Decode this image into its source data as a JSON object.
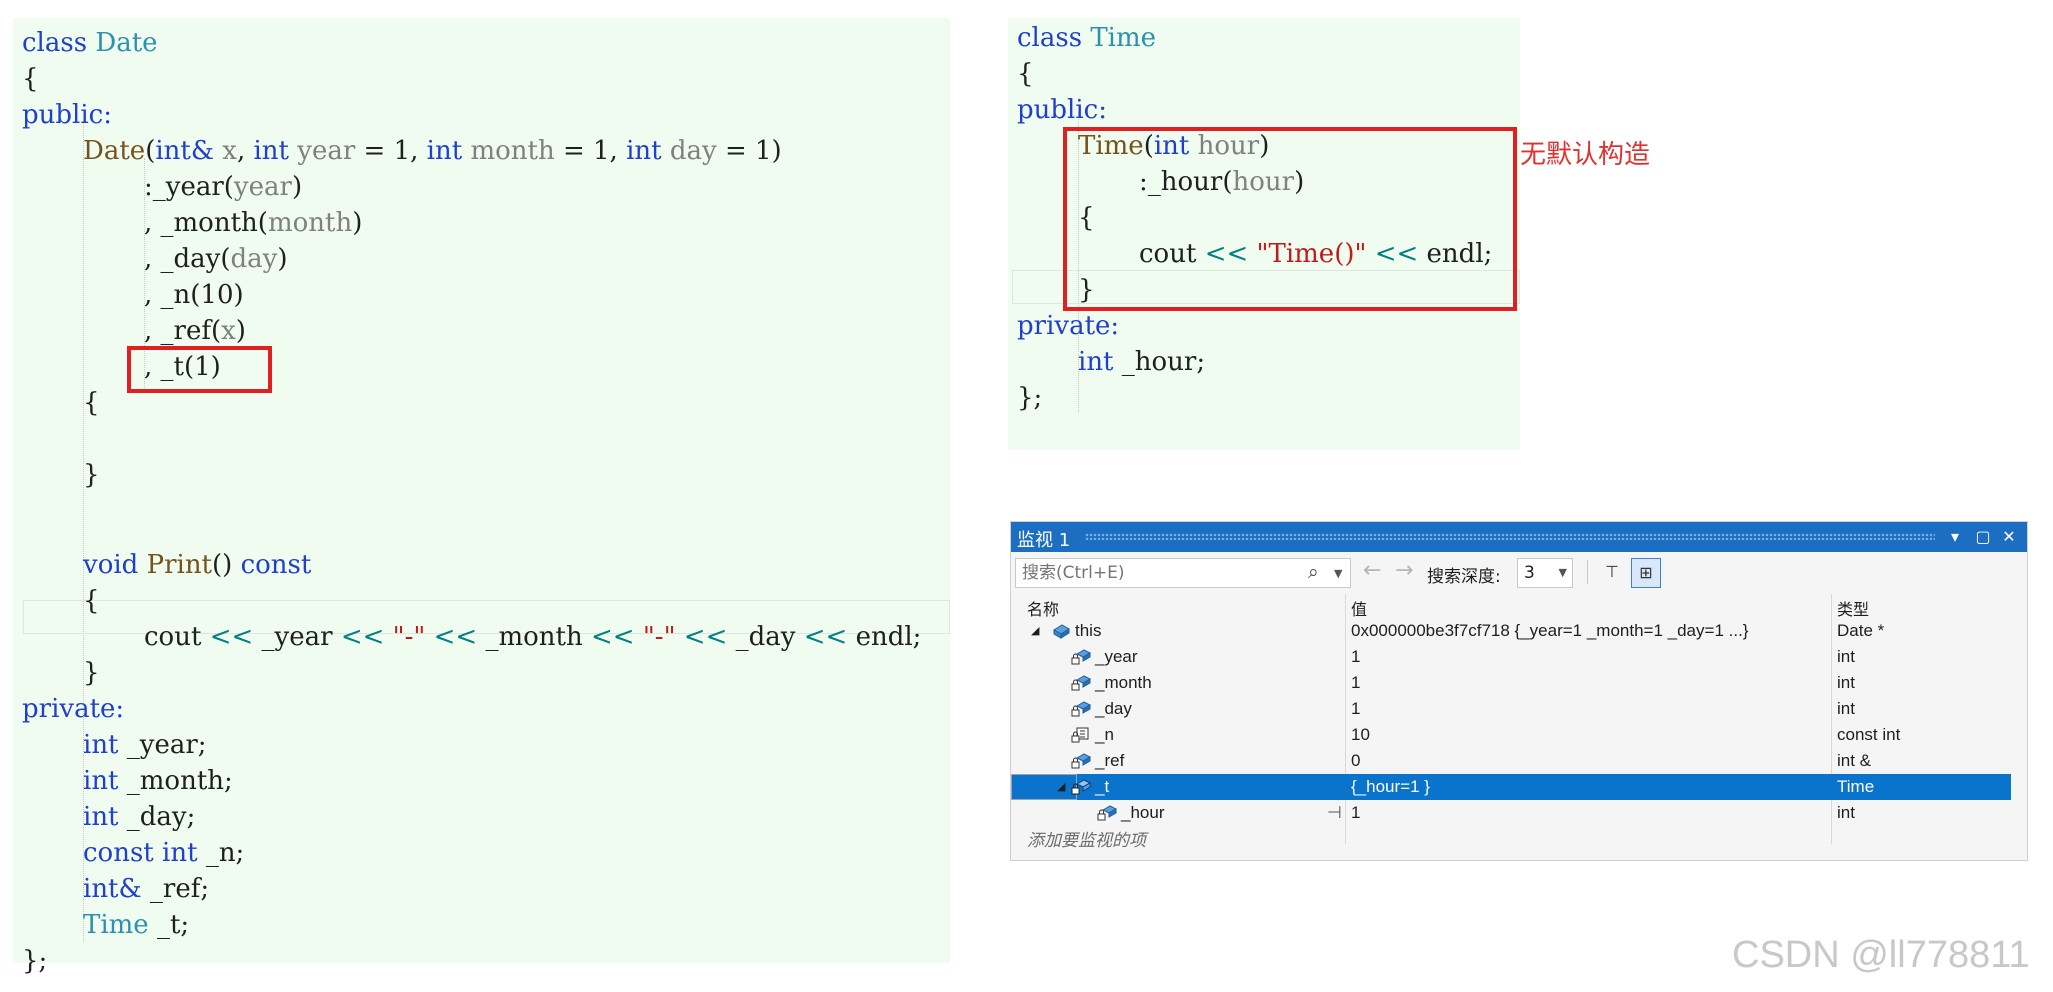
{
  "date_code": {
    "class_kw": "class",
    "class_name": "Date",
    "brace_open": "{",
    "brace_close": "};",
    "public_label": "public:",
    "private_label": "private:",
    "ctor": {
      "name": "Date",
      "p1_type": "int&",
      "p1_name": "x",
      "p2_type": "int",
      "p2_name": "year",
      "p2_def": "= 1,",
      "p3_type": "int",
      "p3_name": "month",
      "p3_def": "= 1,",
      "p4_type": "int",
      "p4_name": "day",
      "p4_def": "= 1)"
    },
    "init_year": ":_year",
    "init_year_arg": "year",
    "init_month": ", _month",
    "init_month_arg": "month",
    "init_day": ", _day",
    "init_day_arg": "day",
    "init_n": ", _n(10)",
    "init_ref": ", _ref",
    "init_ref_arg": "x",
    "init_t": ", _t(1)",
    "ctor_open": "{",
    "ctor_close": "}",
    "print_void": "void",
    "print_name": "Print",
    "print_parens": "()",
    "print_const": "const",
    "print_open": "{",
    "print_close": "}",
    "cout": "cout",
    "op": "<<",
    "v_year": "_year",
    "str_dash": "\"-\"",
    "v_month": "_month",
    "v_day": "_day",
    "endl": "endl;",
    "m_year_t": "int",
    "m_year": "_year;",
    "m_month_t": "int",
    "m_month": "_month;",
    "m_day_t": "int",
    "m_day": "_day;",
    "m_n_c": "const",
    "m_n_t": "int",
    "m_n": "_n;",
    "m_ref_t": "int&",
    "m_ref": "_ref;",
    "m_t_t": "Time",
    "m_t": "_t;"
  },
  "time_code": {
    "class_kw": "class",
    "class_name": "Time",
    "brace_open": "{",
    "brace_close": "};",
    "public_label": "public:",
    "private_label": "private:",
    "ctor_name": "Time",
    "ctor_ptype": "int",
    "ctor_pname": "hour",
    "init_hour": ":_hour",
    "init_hour_arg": "hour",
    "ctor_open": "{",
    "ctor_close": "}",
    "cout": "cout",
    "op": "<<",
    "str": "\"Time()\"",
    "endl": "endl;",
    "m_hour_t": "int",
    "m_hour": "_hour;"
  },
  "annotation": "无默认构造",
  "watch": {
    "title": "监视 1",
    "search_placeholder": "搜索(Ctrl+E)",
    "depth_label": "搜索深度:",
    "depth_value": "3",
    "columns": [
      "名称",
      "值",
      "类型"
    ],
    "rows": [
      {
        "name": "this",
        "value": "0x000000be3f7cf718 {_year=1 _month=1 _day=1 ...}",
        "type": "Date *"
      },
      {
        "name": "_year",
        "value": "1",
        "type": "int"
      },
      {
        "name": "_month",
        "value": "1",
        "type": "int"
      },
      {
        "name": "_day",
        "value": "1",
        "type": "int"
      },
      {
        "name": "_n",
        "value": "10",
        "type": "const int"
      },
      {
        "name": "_ref",
        "value": "0",
        "type": "int &"
      },
      {
        "name": "_t",
        "value": "{_hour=1 }",
        "type": "Time"
      },
      {
        "name": "_hour",
        "value": "1",
        "type": "int"
      }
    ],
    "add_watch": "添加要监视的项"
  },
  "watermark": "CSDN @ll778811",
  "colors": {
    "highlight_box": "#e02020",
    "code_bg": "#f0fcf0",
    "watch_title_bg": "#1b6ec2",
    "selected_row": "#0a73cc"
  }
}
